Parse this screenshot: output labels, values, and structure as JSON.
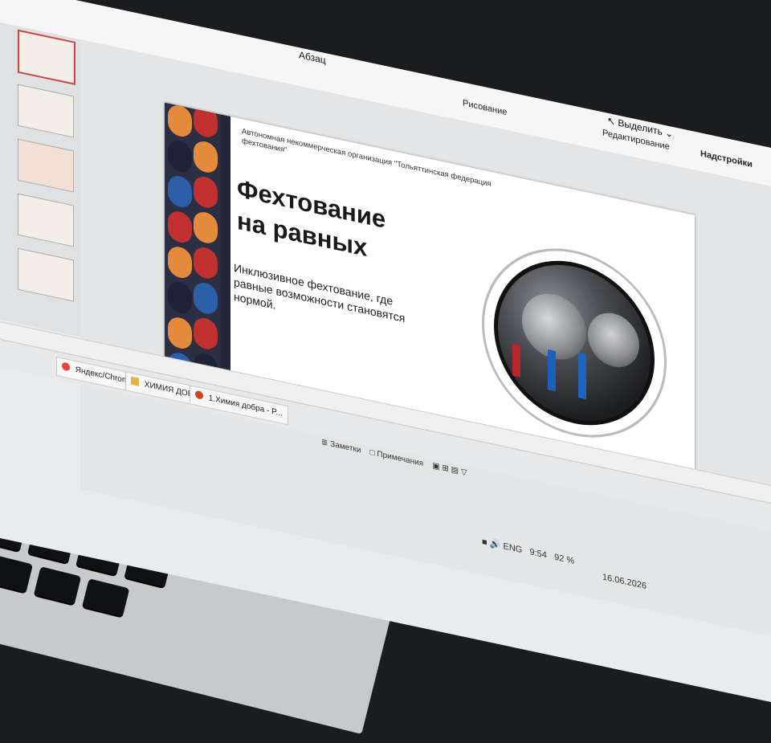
{
  "ribbon": {
    "group_paragraph": "Абзац",
    "group_drawing": "Рисование",
    "group_editing": "Редактирование",
    "group_addins": "Надстройки",
    "select_label": "Выделить"
  },
  "slide": {
    "org_text": "Автономная некоммерческая организация \"Тольяттинская федерация фехтования\"",
    "title_line1": "Фехтование",
    "title_line2": "на равных",
    "subtitle": "Инклюзивное фехтование, где равные возможности становятся нормой."
  },
  "taskbar": {
    "item_chrome": "Яндекс/Chrome",
    "item_folder": "ХИМИЯ ДОБРА",
    "item_ppt": "1.Химия добра - P..."
  },
  "status": {
    "notes_label": "Заметки",
    "comments_label": "Примечания",
    "zoom": "92 %",
    "lang": "ENG",
    "time": "9:54",
    "date": "16.06.2026"
  },
  "colors": {
    "pattern_navy": "#2b2f44",
    "accent_red": "#c0312f",
    "accent_orange": "#e48a3c",
    "accent_blue": "#2d5ea8"
  },
  "icons": [
    "search-icon",
    "notes-icon",
    "comments-icon",
    "normal-view-icon",
    "sorter-view-icon",
    "reading-view-icon",
    "slideshow-icon",
    "volume-icon",
    "network-icon"
  ]
}
